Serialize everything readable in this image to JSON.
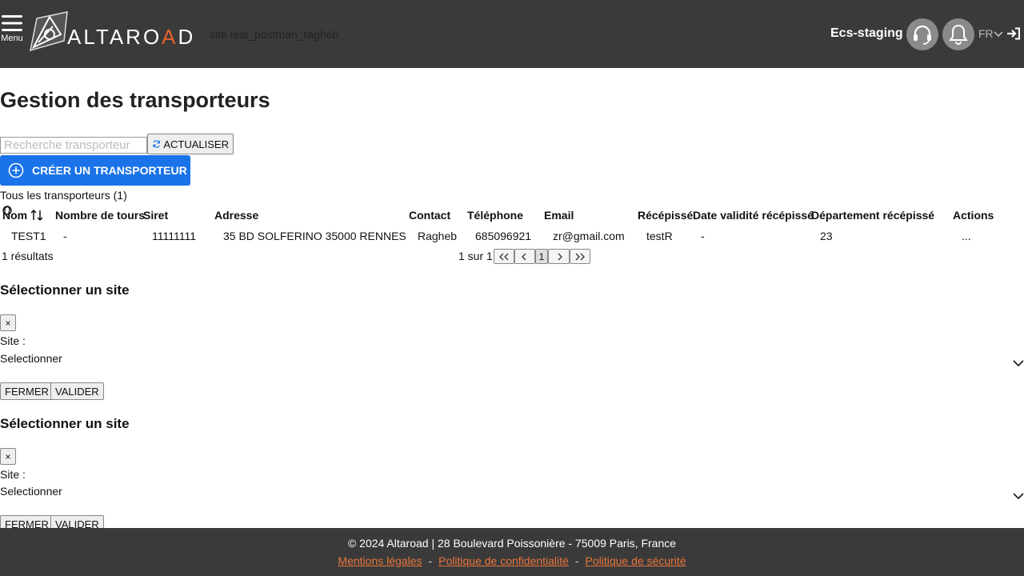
{
  "header": {
    "menu_label": "Menu",
    "logo_text_pre": "ALTARO",
    "logo_text_o": "A",
    "logo_text_post": "D",
    "site_name": "site test_postman_ragheb",
    "env_name": "Ecs-staging",
    "lang": "FR",
    "support_icon": "headset-icon",
    "notif_icon": "bell-icon",
    "logout_icon": "sign-in-icon",
    "bar_color": "#3a3a3a",
    "accent_color": "#e8622c"
  },
  "page": {
    "title": "Gestion des transporteurs",
    "search_placeholder": "Recherche transporteur",
    "refresh_label": "ACTUALISER",
    "create_label": "CRÉER UN TRANSPORTEUR",
    "count_label": "Tous les transporteurs (1)",
    "primary_color": "#1a73e8"
  },
  "table": {
    "columns": [
      "Nom",
      "Nombre de tours",
      "Siret",
      "Adresse",
      "Contact",
      "Téléphone",
      "Email",
      "Récépissé",
      "Date validité récépissé",
      "Département récépissé",
      "Actions"
    ],
    "rows": [
      [
        "TEST1",
        "-",
        "11111111",
        "35 BD SOLFERINO 35000 RENNES",
        "Ragheb",
        "685096921",
        "zr@gmail.com",
        "testR",
        "-",
        "23",
        "..."
      ]
    ],
    "results": "1 résultats",
    "pager_text": "1 sur 1",
    "current_page": "1"
  },
  "modals": [
    {
      "title": "Sélectionner un site",
      "close": "×",
      "label": "Site :",
      "select_value": "Selectionner",
      "cancel": "FERMER",
      "confirm": "VALIDER"
    },
    {
      "title": "Sélectionner un site",
      "close": "×",
      "label": "Site :",
      "select_value": "Selectionner",
      "cancel": "FERMER",
      "confirm": "VALIDER"
    }
  ],
  "footer": {
    "copyright": "© 2024 Altaroad | 28 Boulevard Poissonière - 75009 Paris, France",
    "links": [
      "Mentions légales",
      "Politique de confidentialité",
      "Politique de sécurité"
    ],
    "separator": "-",
    "link_color": "#e8763c"
  }
}
